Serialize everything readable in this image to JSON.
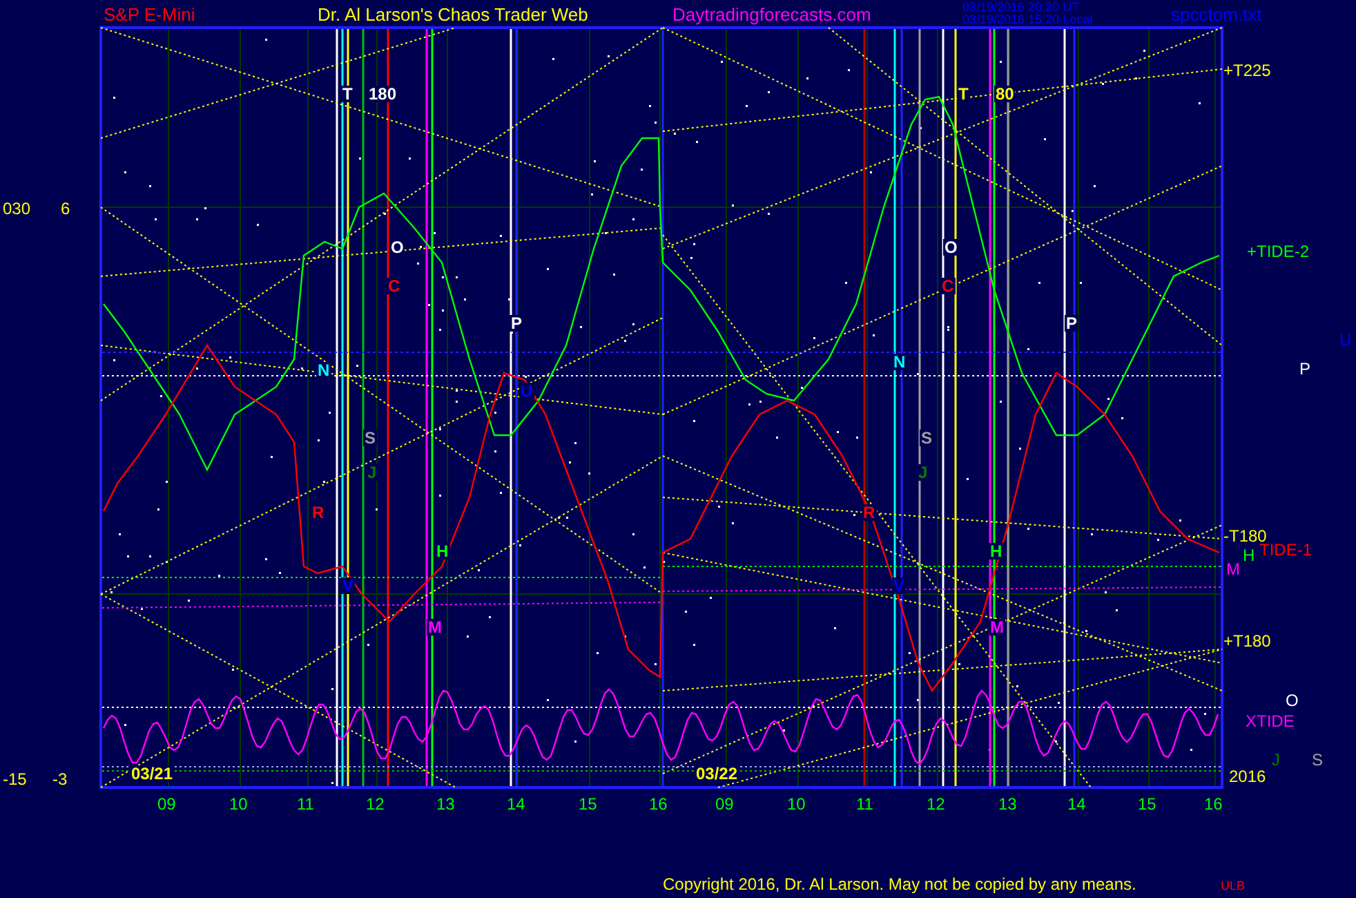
{
  "header": {
    "instrument": "S&P E-Mini",
    "title": "Dr. Al Larson's Chaos Trader Web",
    "site": "Daytradingforecasts.com",
    "timestamps": [
      "03/19/2016 20:20 UT",
      "03/19/2016 15:20 Local"
    ],
    "file": "spcctom.txt"
  },
  "left_axis": [
    {
      "text": "030"
    },
    {
      "text": "6"
    },
    {
      "text": "-15"
    },
    {
      "text": "-3"
    }
  ],
  "plot_labels": [
    {
      "text": "T",
      "color": "#ffffff"
    },
    {
      "text": "180",
      "color": "#ffffff"
    },
    {
      "text": "O",
      "color": "#ffffff"
    },
    {
      "text": "C",
      "color": "#ff0000"
    },
    {
      "text": "P",
      "color": "#ffffff"
    },
    {
      "text": "N",
      "color": "#00ffff"
    },
    {
      "text": "U",
      "color": "#0000ff"
    },
    {
      "text": "S",
      "color": "#a0a0a0"
    },
    {
      "text": "J",
      "color": "#008000"
    },
    {
      "text": "R",
      "color": "#ff0000"
    },
    {
      "text": "H",
      "color": "#00ff00"
    },
    {
      "text": "V",
      "color": "#0000ff"
    },
    {
      "text": "M",
      "color": "#ff00ff"
    },
    {
      "text": "T",
      "color": "#ffff00"
    },
    {
      "text": "80",
      "color": "#ffff00"
    },
    {
      "text": "O",
      "color": "#ffffff"
    },
    {
      "text": "C",
      "color": "#ff0000"
    },
    {
      "text": "P",
      "color": "#ffffff"
    },
    {
      "text": "N",
      "color": "#00ffff"
    },
    {
      "text": "S",
      "color": "#a0a0a0"
    },
    {
      "text": "J",
      "color": "#008000"
    },
    {
      "text": "R",
      "color": "#ff0000"
    },
    {
      "text": "H",
      "color": "#00ff00"
    },
    {
      "text": "V",
      "color": "#0000ff"
    },
    {
      "text": "M",
      "color": "#ff00ff"
    }
  ],
  "dates": [
    "03/21",
    "03/22"
  ],
  "right_labels": [
    {
      "text": "+T225",
      "color": "#ffff00"
    },
    {
      "text": "+TIDE-2",
      "color": "#00ff00"
    },
    {
      "text": "U",
      "color": "#0000ff"
    },
    {
      "text": "P",
      "color": "#ffffff"
    },
    {
      "text": "-T180",
      "color": "#ffff00"
    },
    {
      "text": "TIDE-1",
      "color": "#ff0000"
    },
    {
      "text": "H",
      "color": "#00ff00"
    },
    {
      "text": "M",
      "color": "#ff00ff"
    },
    {
      "text": "+T180",
      "color": "#ffff00"
    },
    {
      "text": "O",
      "color": "#ffffff"
    },
    {
      "text": "XTIDE",
      "color": "#ff00ff"
    },
    {
      "text": "J",
      "color": "#008000"
    },
    {
      "text": "S",
      "color": "#a0a0a0"
    },
    {
      "text": "2016",
      "color": "#ffff00"
    }
  ],
  "hours": [
    "09",
    "10",
    "11",
    "12",
    "13",
    "14",
    "15",
    "16",
    "09",
    "10",
    "11",
    "12",
    "13",
    "14",
    "15",
    "16"
  ],
  "footer": {
    "copyright": "Copyright 2016, Dr. Al Larson. May not be copied by any means.",
    "mark": "ULB"
  }
}
